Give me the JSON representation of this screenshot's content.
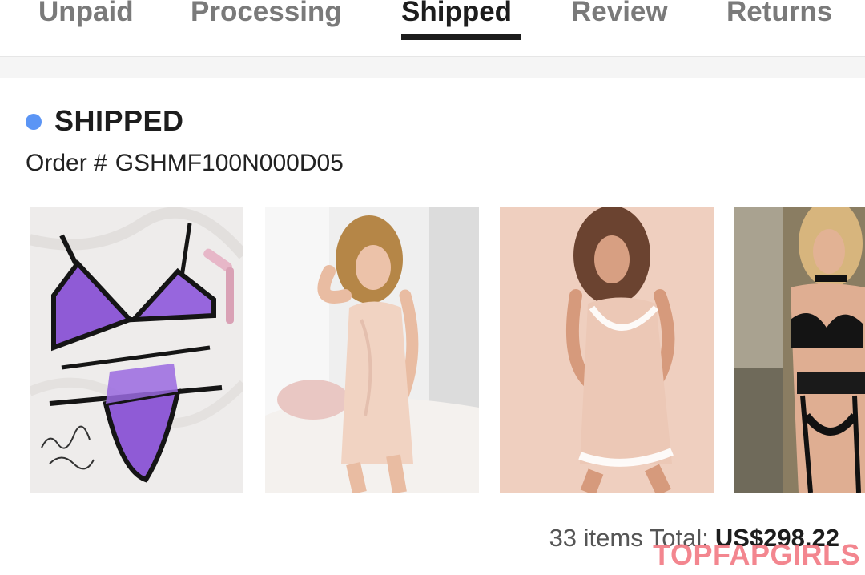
{
  "tabs": [
    {
      "label": "Unpaid",
      "active": false
    },
    {
      "label": "Processing",
      "active": false
    },
    {
      "label": "Shipped",
      "active": true
    },
    {
      "label": "Review",
      "active": false
    },
    {
      "label": "Returns",
      "active": false
    }
  ],
  "order": {
    "status": "SHIPPED",
    "status_color": "#5b95f5",
    "order_label": "Order #",
    "order_number": "GSHMF100N000D05"
  },
  "items": [
    {
      "name": "purple-lingerie-set-product-image"
    },
    {
      "name": "pink-satin-slip-dress-product-image"
    },
    {
      "name": "pink-satin-lace-trim-chemise-product-image"
    },
    {
      "name": "black-lace-lingerie-set-product-image"
    }
  ],
  "footer": {
    "items_total_label": "33 items Total:",
    "total_amount": "US$298.22"
  },
  "watermark": {
    "text": "TOPFAPGIRLS"
  }
}
